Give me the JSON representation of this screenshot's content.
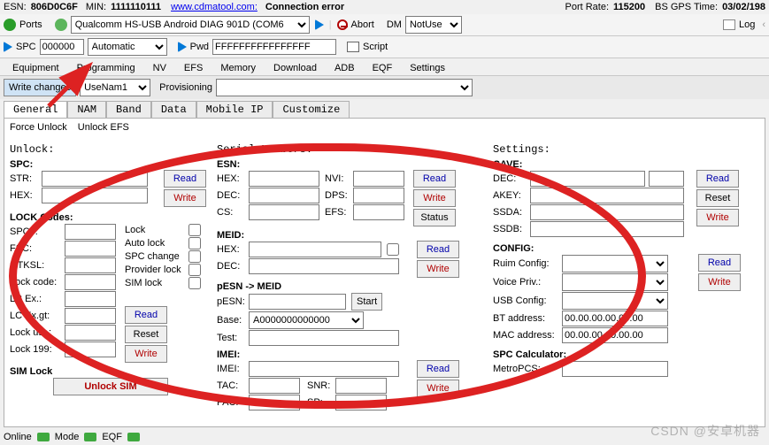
{
  "top": {
    "esn_label": "ESN:",
    "esn_value": "806D0C6F",
    "min_label": "MIN:",
    "min_value": "1111110111",
    "link_text": "www.cdmatool.com:",
    "conn_status": "Connection error",
    "port_rate_label": "Port Rate:",
    "port_rate_value": "115200",
    "gps_label": "BS GPS Time:",
    "gps_value": "03/02/198"
  },
  "toolbar": {
    "ports": "Ports",
    "port_select": "Qualcomm HS-USB Android DIAG 901D (COM6",
    "abort": "Abort",
    "dm": "DM",
    "dm_select": "NotUse",
    "log": "Log"
  },
  "toolbar2": {
    "spc_label": "SPC",
    "spc_value": "000000",
    "spc_mode": "Automatic",
    "pwd_label": "Pwd",
    "pwd_value": "FFFFFFFFFFFFFFFF",
    "script": "Script"
  },
  "menubar": {
    "equipment": "Equipment",
    "programming": "Programming",
    "nv": "NV",
    "efs": "EFS",
    "memory": "Memory",
    "download": "Download",
    "adb": "ADB",
    "eqf": "EQF",
    "settings": "Settings"
  },
  "underbar": {
    "write_changes": "Write changes",
    "usenam": "UseNam1",
    "prov": "Provisioning"
  },
  "tabs": {
    "general": "General",
    "nam": "NAM",
    "band": "Band",
    "data": "Data",
    "mobileip": "Mobile IP",
    "customize": "Customize"
  },
  "locklinks": {
    "force": "Force Unlock",
    "unlockefs": "Unlock EFS"
  },
  "unlock": {
    "title": "Unlock:",
    "spc_title": "SPC:",
    "str": "STR:",
    "hex_label": "HEX:",
    "read": "Read",
    "write": "Write",
    "lockcodes_title": "LOCK Codes:",
    "spc3": "SPC3:",
    "fsc": "FSC:",
    "otksl": "OTKSL:",
    "lockcode": "Lock code:",
    "lcex": "LC Ex.:",
    "lcexgt": "LC Ex.gt:",
    "lockusr": "Lock usr.:",
    "lock199": "Lock 199:",
    "lock_chk": "Lock",
    "autolock_chk": "Auto lock",
    "spcchange_chk": "SPC change",
    "provider_chk": "Provider lock",
    "simlock_chk": "SIM lock",
    "reset": "Reset",
    "simlock_title": "SIM Lock",
    "unlocksim_btn": "Unlock SIM"
  },
  "serial": {
    "title": "Serial Numbers:",
    "esn_title": "ESN:",
    "hex": "HEX:",
    "dec": "DEC:",
    "cs": "CS:",
    "nvi": "NVI:",
    "dps": "DPS:",
    "efs": "EFS:",
    "read": "Read",
    "write": "Write",
    "status": "Status",
    "meid_title": "MEID:",
    "pesn_title": "pESN -> MEID",
    "pesn": "pESN:",
    "start": "Start",
    "base": "Base:",
    "base_value": "A0000000000000",
    "test": "Test:",
    "imei_title": "IMEI:",
    "imei": "IMEI:",
    "tac": "TAC:",
    "fac": "FAC:",
    "snr": "SNR:",
    "sp": "SP:"
  },
  "settings": {
    "title": "Settings:",
    "cave": "CAVE:",
    "dec": "DEC:",
    "akey": "AKEY:",
    "ssda": "SSDA:",
    "ssdb": "SSDB:",
    "read": "Read",
    "reset": "Reset",
    "write": "Write",
    "config_title": "CONFIG:",
    "ruim": "Ruim Config:",
    "voice": "Voice Priv.:",
    "usb": "USB Config:",
    "bt": "BT address:",
    "bt_value": "00.00.00.00.00.00",
    "mac": "MAC address:",
    "mac_value": "00.00.00.00.00.00",
    "spccalc_title": "SPC Calculator:",
    "metro": "MetroPCS:"
  },
  "status": {
    "online": "Online",
    "mode": "Mode",
    "eqf": "EQF"
  },
  "watermark": "CSDN @安卓机器"
}
